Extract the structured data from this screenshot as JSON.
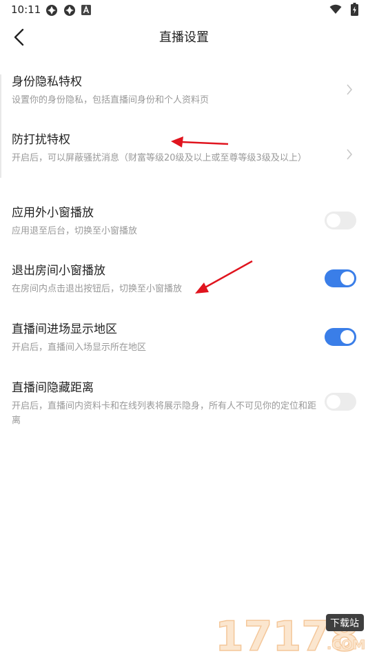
{
  "status_bar": {
    "time": "10:11",
    "left_icons": [
      "sync-icon",
      "sync-icon",
      "app-a-icon"
    ],
    "right_icons": [
      "wifi-icon",
      "battery-charging-icon"
    ]
  },
  "header": {
    "title": "直播设置",
    "back_icon": "chevron-left-icon"
  },
  "settings": [
    {
      "title": "身份隐私特权",
      "desc": "设置你的身份隐私，包括直播间身份和个人资料页",
      "control": "chevron"
    },
    {
      "title": "防打扰特权",
      "desc": "开启后，可以屏蔽骚扰消息（财富等级20级及以上或至尊等级3级及以上）",
      "control": "chevron"
    },
    {
      "title": "应用外小窗播放",
      "desc": "应用退至后台，切换至小窗播放",
      "control": "toggle",
      "on": false
    },
    {
      "title": "退出房间小窗播放",
      "desc": "在房间内点击退出按钮后，切换至小窗播放",
      "control": "toggle",
      "on": true
    },
    {
      "title": "直播间进场显示地区",
      "desc": "开启后，直播间入场显示所在地区",
      "control": "toggle",
      "on": true
    },
    {
      "title": "直播间隐藏距离",
      "desc": "开启后，直播间内资料卡和在线列表将展示隐身，所有人不可见你的定位和距离",
      "control": "toggle",
      "on": false
    }
  ],
  "colors": {
    "accent": "#3a7ee8",
    "toggle_off": "#ececec",
    "annotation_arrow": "#e0141e"
  },
  "watermark": {
    "number": "17178",
    "badge": "下载站",
    "domain": ".COM"
  }
}
